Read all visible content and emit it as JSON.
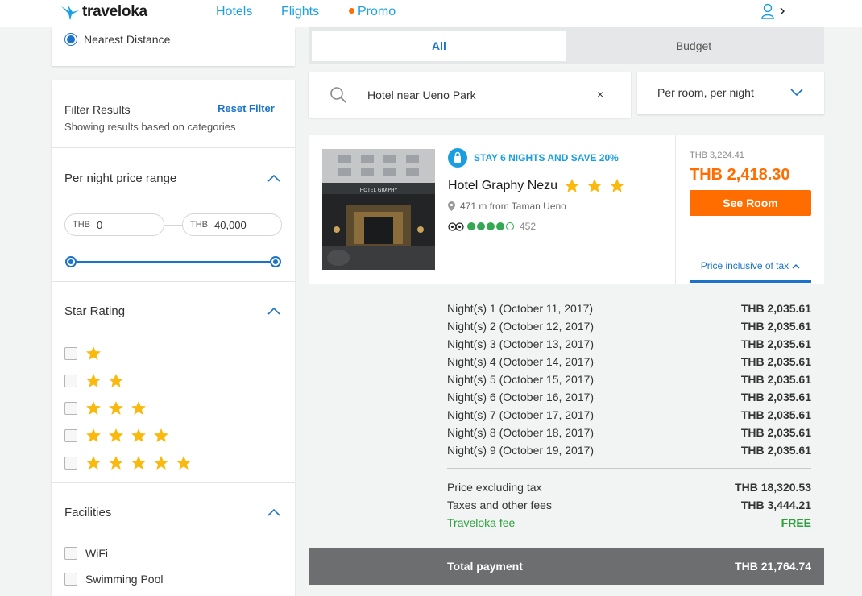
{
  "nav": {
    "logo": "traveloka",
    "hotels": "Hotels",
    "flights": "Flights",
    "promo": "Promo"
  },
  "sort": {
    "selected": "Nearest Distance"
  },
  "filter": {
    "title": "Filter Results",
    "reset": "Reset Filter",
    "subtitle": "Showing results based on categories",
    "price_range": {
      "title": "Per night price range",
      "min_currency": "THB",
      "min": "0",
      "max_currency": "THB",
      "max": "40,000"
    },
    "star_rating": {
      "title": "Star Rating",
      "options": [
        1,
        2,
        3,
        4,
        5
      ]
    },
    "facilities": {
      "title": "Facilities",
      "items": [
        "WiFi",
        "Swimming Pool"
      ]
    }
  },
  "tabs": [
    {
      "label": "All",
      "active": true
    },
    {
      "label": "Budget",
      "active": false
    }
  ],
  "search": {
    "value": "Hotel near Ueno Park",
    "clear": "×"
  },
  "price_mode": "Per room, per night",
  "hotel": {
    "promo": "STAY 6 NIGHTS AND SAVE 20%",
    "name": "Hotel Graphy Nezu",
    "stars": 3,
    "distance": "471 m from Taman Ueno",
    "review_rating": 4,
    "review_count": "452",
    "image_sign": "HOTEL GRAPHY",
    "old_price": "THB 3,224.41",
    "price": "THB 2,418.30",
    "cta": "See Room",
    "tax_toggle": "Price inclusive of tax"
  },
  "breakdown": {
    "nights": [
      {
        "label": "Night(s) 1 (October 11, 2017)",
        "amount": "THB 2,035.61"
      },
      {
        "label": "Night(s) 2 (October 12, 2017)",
        "amount": "THB 2,035.61"
      },
      {
        "label": "Night(s) 3 (October 13, 2017)",
        "amount": "THB 2,035.61"
      },
      {
        "label": "Night(s) 4 (October 14, 2017)",
        "amount": "THB 2,035.61"
      },
      {
        "label": "Night(s) 5 (October 15, 2017)",
        "amount": "THB 2,035.61"
      },
      {
        "label": "Night(s) 6 (October 16, 2017)",
        "amount": "THB 2,035.61"
      },
      {
        "label": "Night(s) 7 (October 17, 2017)",
        "amount": "THB 2,035.61"
      },
      {
        "label": "Night(s) 8 (October 18, 2017)",
        "amount": "THB 2,035.61"
      },
      {
        "label": "Night(s) 9 (October 19, 2017)",
        "amount": "THB 2,035.61"
      }
    ],
    "excl_tax_label": "Price excluding tax",
    "excl_tax": "THB 18,320.53",
    "taxes_label": "Taxes and other fees",
    "taxes": "THB 3,444.21",
    "fee_label": "Traveloka fee",
    "fee": "FREE",
    "total_label": "Total payment",
    "total": "THB 21,764.74"
  },
  "colors": {
    "brand_blue": "#1ba0e2",
    "accent_blue": "#1a73c9",
    "orange": "#ff6d00",
    "star": "#f9b90f",
    "green": "#2aa13a"
  }
}
